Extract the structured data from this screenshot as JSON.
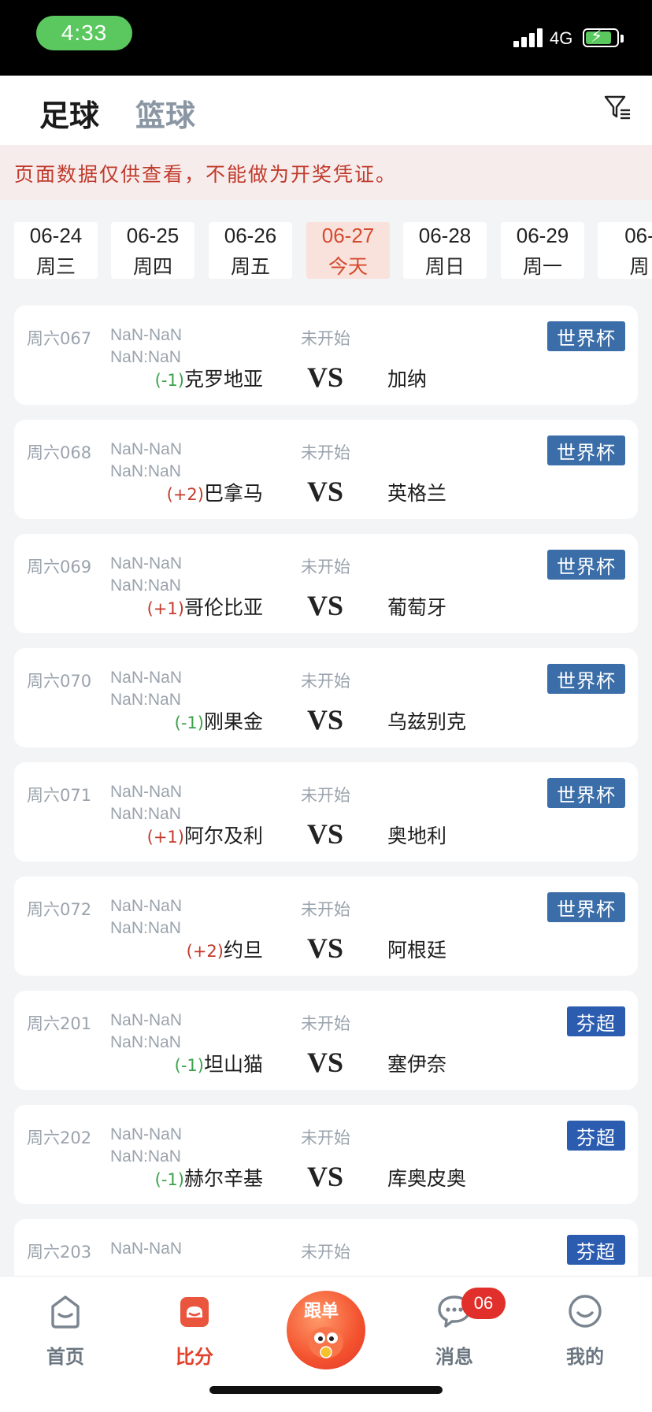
{
  "status_bar": {
    "time": "4:33",
    "network": "4G"
  },
  "header": {
    "tabs": [
      {
        "label": "足球",
        "active": true
      },
      {
        "label": "篮球",
        "active": false
      }
    ]
  },
  "notice": "页面数据仅供查看，不能做为开奖凭证。",
  "dates": [
    {
      "date": "06-24",
      "weekday": "周三",
      "active": false
    },
    {
      "date": "06-25",
      "weekday": "周四",
      "active": false
    },
    {
      "date": "06-26",
      "weekday": "周五",
      "active": false
    },
    {
      "date": "06-27",
      "weekday": "今天",
      "active": true
    },
    {
      "date": "06-28",
      "weekday": "周日",
      "active": false
    },
    {
      "date": "06-29",
      "weekday": "周一",
      "active": false
    },
    {
      "date": "06-",
      "weekday": "周",
      "active": false
    }
  ],
  "matches": [
    {
      "code": "周六067",
      "score1": "NaN-NaN",
      "score2": "NaN:NaN",
      "status": "未开始",
      "handicap": "(-1)",
      "home": "克罗地亚",
      "vs": "VS",
      "away": "加纳",
      "league": "世界杯"
    },
    {
      "code": "周六068",
      "score1": "NaN-NaN",
      "score2": "NaN:NaN",
      "status": "未开始",
      "handicap": "(+2)",
      "home": "巴拿马",
      "vs": "VS",
      "away": "英格兰",
      "league": "世界杯"
    },
    {
      "code": "周六069",
      "score1": "NaN-NaN",
      "score2": "NaN:NaN",
      "status": "未开始",
      "handicap": "(+1)",
      "home": "哥伦比亚",
      "vs": "VS",
      "away": "葡萄牙",
      "league": "世界杯"
    },
    {
      "code": "周六070",
      "score1": "NaN-NaN",
      "score2": "NaN:NaN",
      "status": "未开始",
      "handicap": "(-1)",
      "home": "刚果金",
      "vs": "VS",
      "away": "乌兹别克",
      "league": "世界杯"
    },
    {
      "code": "周六071",
      "score1": "NaN-NaN",
      "score2": "NaN:NaN",
      "status": "未开始",
      "handicap": "(+1)",
      "home": "阿尔及利",
      "vs": "VS",
      "away": "奥地利",
      "league": "世界杯"
    },
    {
      "code": "周六072",
      "score1": "NaN-NaN",
      "score2": "NaN:NaN",
      "status": "未开始",
      "handicap": "(+2)",
      "home": "约旦",
      "vs": "VS",
      "away": "阿根廷",
      "league": "世界杯"
    },
    {
      "code": "周六201",
      "score1": "NaN-NaN",
      "score2": "NaN:NaN",
      "status": "未开始",
      "handicap": "(-1)",
      "home": "坦山猫",
      "vs": "VS",
      "away": "塞伊奈",
      "league": "芬超"
    },
    {
      "code": "周六202",
      "score1": "NaN-NaN",
      "score2": "NaN:NaN",
      "status": "未开始",
      "handicap": "(-1)",
      "home": "赫尔辛基",
      "vs": "VS",
      "away": "库奥皮奥",
      "league": "芬超"
    },
    {
      "code": "周六203",
      "score1": "NaN-NaN",
      "score2": "",
      "status": "未开始",
      "handicap": "",
      "home": "",
      "vs": "",
      "away": "",
      "league": "芬超"
    }
  ],
  "tabbar": {
    "items": [
      {
        "label": "首页",
        "icon": "home-icon",
        "active": false
      },
      {
        "label": "比分",
        "icon": "score-icon",
        "active": true
      },
      {
        "label": "跟单",
        "icon": "follow-mascot-icon",
        "active": false
      },
      {
        "label": "消息",
        "icon": "message-icon",
        "active": false
      },
      {
        "label": "我的",
        "icon": "profile-icon",
        "active": false
      }
    ],
    "message_badge": "06"
  },
  "colors": {
    "accent_red": "#e1422b",
    "league_blue": "#3b6ea8",
    "handicap_neg": "#3aa24a",
    "handicap_pos": "#c33a2a"
  }
}
